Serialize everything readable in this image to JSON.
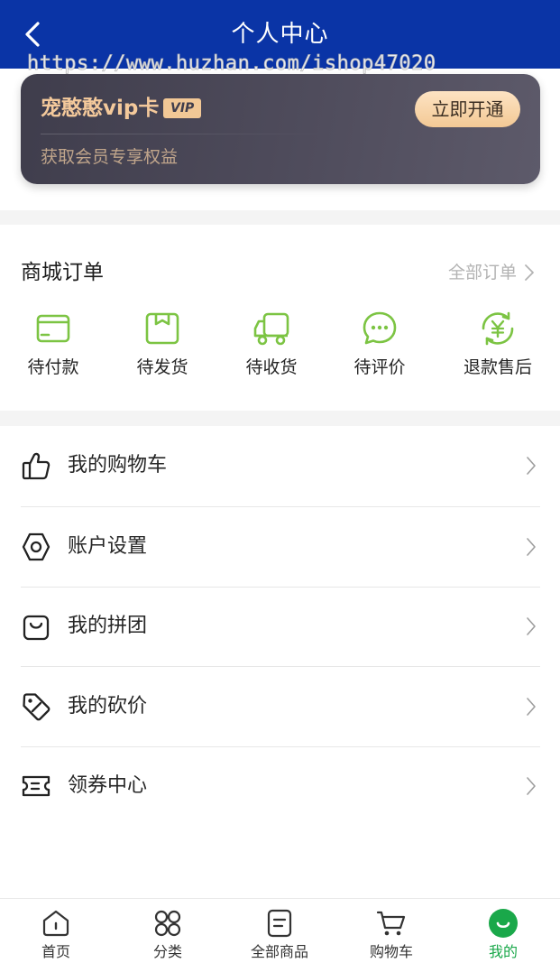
{
  "header": {
    "title": "个人中心"
  },
  "watermark": "https://www.huzhan.com/ishop47020",
  "vip": {
    "title": "宠憨憨vip卡",
    "badge": "VIP",
    "button_label": "立即开通",
    "subtitle": "获取会员专享权益"
  },
  "orders": {
    "title": "商城订单",
    "all_label": "全部订单",
    "items": [
      {
        "label": "待付款",
        "icon": "wallet-icon"
      },
      {
        "label": "待发货",
        "icon": "package-icon"
      },
      {
        "label": "待收货",
        "icon": "truck-icon"
      },
      {
        "label": "待评价",
        "icon": "chat-bubble-icon"
      },
      {
        "label": "退款售后",
        "icon": "refund-yen-icon"
      }
    ]
  },
  "menu": [
    {
      "label": "我的购物车",
      "icon": "thumbs-up-icon"
    },
    {
      "label": "账户设置",
      "icon": "settings-hex-icon"
    },
    {
      "label": "我的拼团",
      "icon": "bag-icon"
    },
    {
      "label": "我的砍价",
      "icon": "tag-discount-icon"
    },
    {
      "label": "领券中心",
      "icon": "coupon-icon"
    }
  ],
  "tabbar": [
    {
      "label": "首页",
      "icon": "home-icon",
      "active": false
    },
    {
      "label": "分类",
      "icon": "category-grid-icon",
      "active": false
    },
    {
      "label": "全部商品",
      "icon": "document-icon",
      "active": false
    },
    {
      "label": "购物车",
      "icon": "cart-icon",
      "active": false
    },
    {
      "label": "我的",
      "icon": "smile-profile-icon",
      "active": true
    }
  ],
  "colors": {
    "header_bg": "#0a34a6",
    "accent_green": "#7cc443",
    "active_tab_green": "#1aa84a",
    "vip_gold": "#f4c99b"
  }
}
